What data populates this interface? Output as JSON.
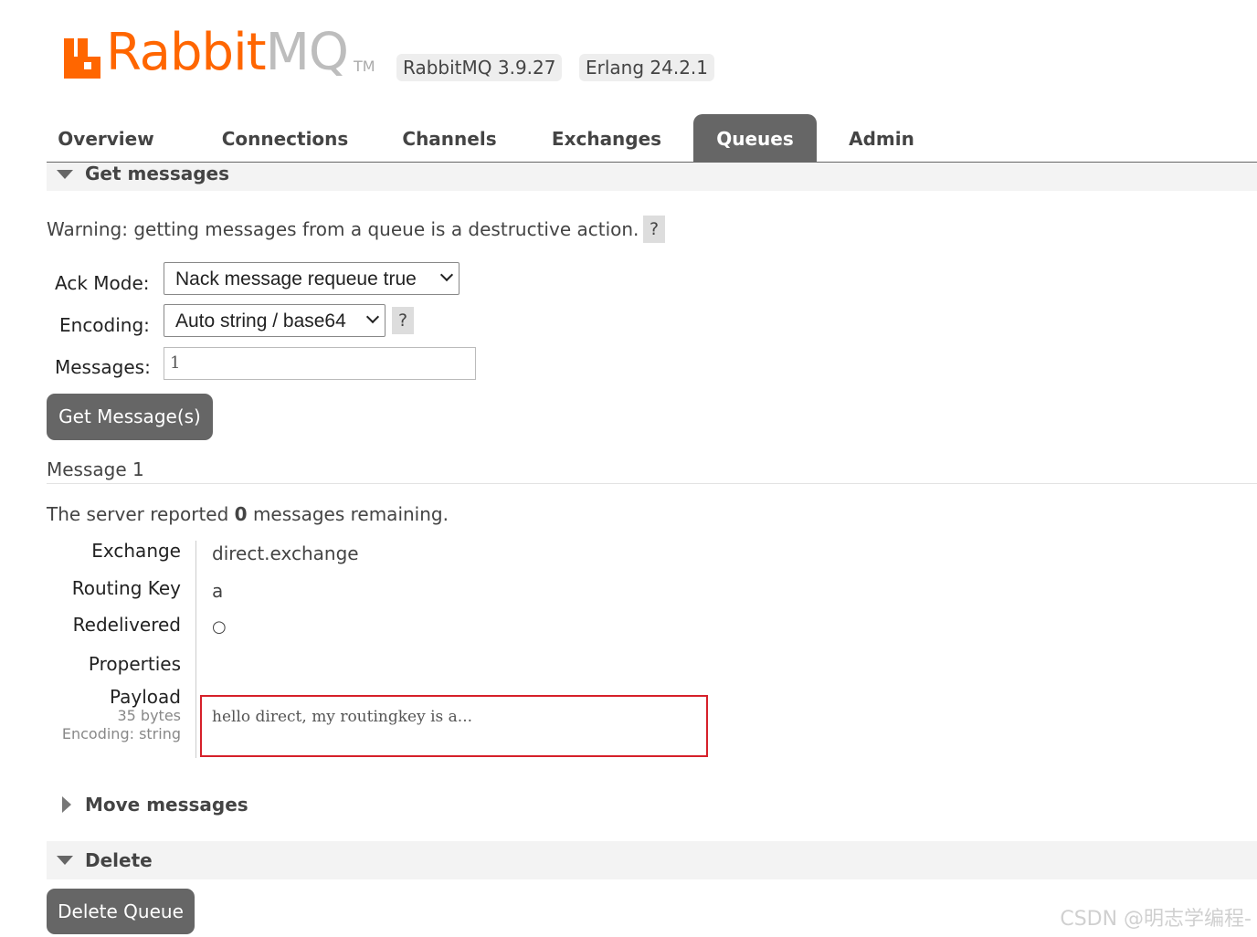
{
  "header": {
    "brand_part1": "Rabbit",
    "brand_part2": "MQ",
    "trademark": "TM",
    "versions": [
      "RabbitMQ 3.9.27",
      "Erlang 24.2.1"
    ],
    "brand_color": "#ff6600"
  },
  "nav": {
    "tabs": [
      {
        "label": "Overview",
        "active": false
      },
      {
        "label": "Connections",
        "active": false
      },
      {
        "label": "Channels",
        "active": false
      },
      {
        "label": "Exchanges",
        "active": false
      },
      {
        "label": "Queues",
        "active": true
      },
      {
        "label": "Admin",
        "active": false
      }
    ]
  },
  "get_messages": {
    "title": "Get messages",
    "warning": "Warning: getting messages from a queue is a destructive action.",
    "help_label": "?",
    "ack_mode_label": "Ack Mode:",
    "ack_mode_value": "Nack message requeue true",
    "encoding_label": "Encoding:",
    "encoding_value": "Auto string / base64",
    "messages_label": "Messages:",
    "messages_value": "1",
    "get_button": "Get Message(s)"
  },
  "message": {
    "heading": "Message 1",
    "remaining_prefix": "The server reported ",
    "remaining_count": "0",
    "remaining_suffix": " messages remaining.",
    "fields": {
      "exchange_label": "Exchange",
      "exchange_value": "direct.exchange",
      "routing_key_label": "Routing Key",
      "routing_key_value": "a",
      "redelivered_label": "Redelivered",
      "redelivered_value": "○",
      "properties_label": "Properties",
      "payload_label": "Payload",
      "payload_size": "35 bytes",
      "payload_encoding": "Encoding: string",
      "payload_value": "hello direct, my routingkey is a..."
    }
  },
  "move_messages": {
    "title": "Move messages"
  },
  "delete": {
    "title": "Delete",
    "button": "Delete Queue"
  },
  "watermark": "CSDN @明志学编程-"
}
